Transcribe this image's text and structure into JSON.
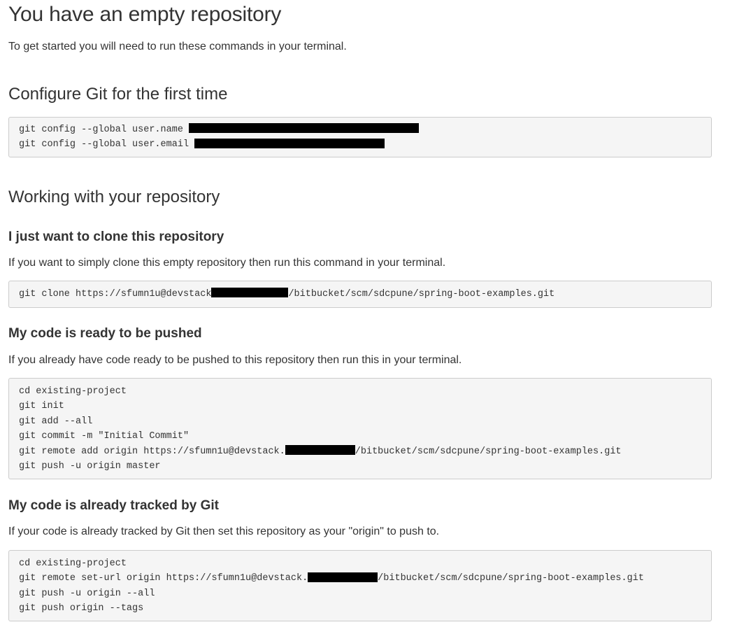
{
  "page_title": "You have an empty repository",
  "intro": "To get started you will need to run these commands in your terminal.",
  "configure": {
    "heading": "Configure Git for the first time",
    "lines": [
      "git config --global user.name ",
      "git config --global user.email "
    ]
  },
  "working": {
    "heading": "Working with your repository"
  },
  "clone": {
    "heading": "I just want to clone this repository",
    "description": "If you want to simply clone this empty repository then run this command in your terminal.",
    "line_prefix": "git clone https://sfumn1u@devstack",
    "line_suffix": "/bitbucket/scm/sdcpune/spring-boot-examples.git"
  },
  "push": {
    "heading": "My code is ready to be pushed",
    "description": "If you already have code ready to be pushed to this repository then run this in your terminal.",
    "lines": [
      "cd existing-project",
      "git init",
      "git add --all",
      "git commit -m \"Initial Commit\""
    ],
    "remote_prefix": "git remote add origin https://sfumn1u@devstack.",
    "remote_suffix": "/bitbucket/scm/sdcpune/spring-boot-examples.git",
    "last_line": "git push -u origin master"
  },
  "tracked": {
    "heading": "My code is already tracked by Git",
    "description": "If your code is already tracked by Git then set this repository as your \"origin\" to push to.",
    "first_line": "cd existing-project",
    "remote_prefix": "git remote set-url origin https://sfumn1u@devstack.",
    "remote_suffix": "/bitbucket/scm/sdcpune/spring-boot-examples.git",
    "lines_after": [
      "git push -u origin --all",
      "git push origin --tags"
    ]
  },
  "colors": {
    "code_background": "#f5f5f5",
    "code_border": "#cccccc",
    "redaction": "#000000",
    "text": "#333333"
  }
}
